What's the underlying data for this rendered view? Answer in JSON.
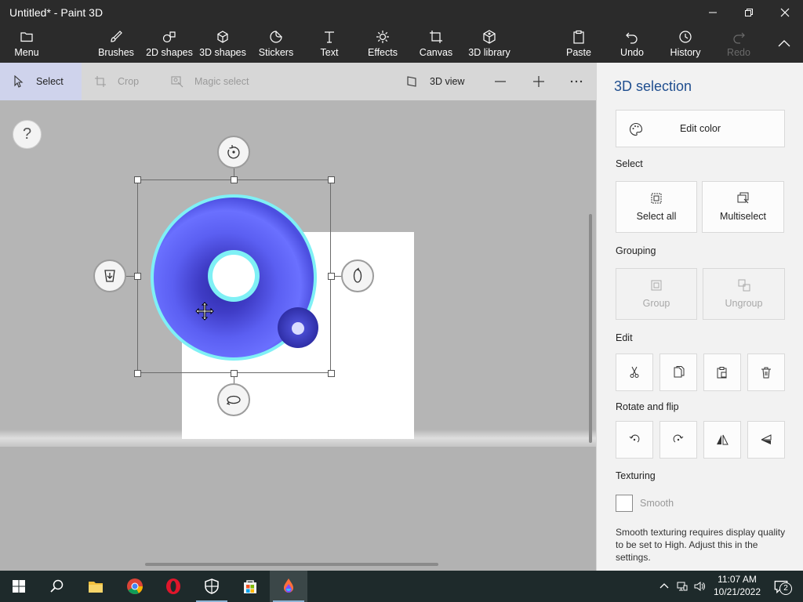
{
  "window": {
    "title": "Untitled* - Paint 3D"
  },
  "ribbon": {
    "menu": "Menu",
    "brushes": "Brushes",
    "shapes_2d": "2D shapes",
    "shapes_3d": "3D shapes",
    "stickers": "Stickers",
    "text": "Text",
    "effects": "Effects",
    "canvas": "Canvas",
    "library_3d": "3D library",
    "paste": "Paste",
    "undo": "Undo",
    "history": "History",
    "redo": "Redo"
  },
  "toolbar": {
    "select": "Select",
    "crop": "Crop",
    "magic_select": "Magic select",
    "view_3d": "3D view"
  },
  "canvas": {
    "help": "?"
  },
  "panel": {
    "title": "3D selection",
    "edit_color": "Edit color",
    "select_heading": "Select",
    "select_all": "Select all",
    "multiselect": "Multiselect",
    "grouping_heading": "Grouping",
    "group": "Group",
    "ungroup": "Ungroup",
    "edit_heading": "Edit",
    "rotate_heading": "Rotate and flip",
    "texturing_heading": "Texturing",
    "smooth": "Smooth",
    "smooth_checked": false,
    "smooth_note": "Smooth texturing requires display quality to be set to High. Adjust this in the settings."
  },
  "taskbar": {
    "time": "11:07 AM",
    "date": "10/21/2022",
    "notification_count": "2"
  },
  "colors": {
    "accent": "#1f4e8f",
    "torus": "#5a5ef2",
    "selection_glow": "#7ff0f5"
  }
}
